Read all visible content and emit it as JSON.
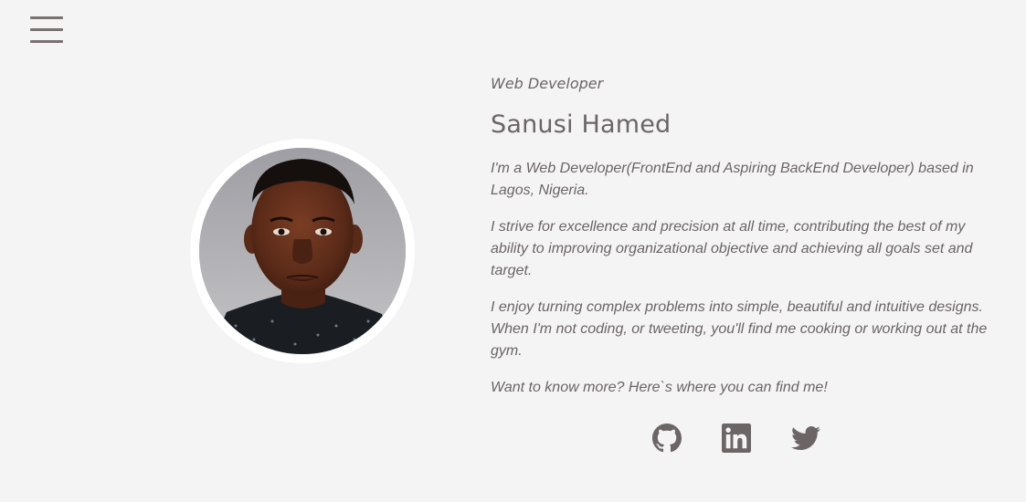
{
  "header": {
    "menu_icon": "hamburger-menu-icon"
  },
  "profile": {
    "subtitle": "Web Developer",
    "name": "Sanusi Hamed",
    "paragraphs": [
      "I'm a Web Developer(FrontEnd and Aspiring BackEnd Developer) based in Lagos, Nigeria.",
      "I strive for excellence and precision at all time, contributing the best of my ability to improving organizational objective and achieving all goals set and target.",
      "I enjoy turning complex problems into simple, beautiful and intuitive designs. When I'm not coding, or tweeting, you'll find me cooking or working out at the gym.",
      "Want to know more? Here`s where you can find me!"
    ]
  },
  "socials": [
    {
      "icon": "github-icon"
    },
    {
      "icon": "linkedin-icon"
    },
    {
      "icon": "twitter-icon"
    }
  ],
  "colors": {
    "background": "#f4f4f4",
    "text": "#6b6566",
    "ring": "#ffffff"
  }
}
